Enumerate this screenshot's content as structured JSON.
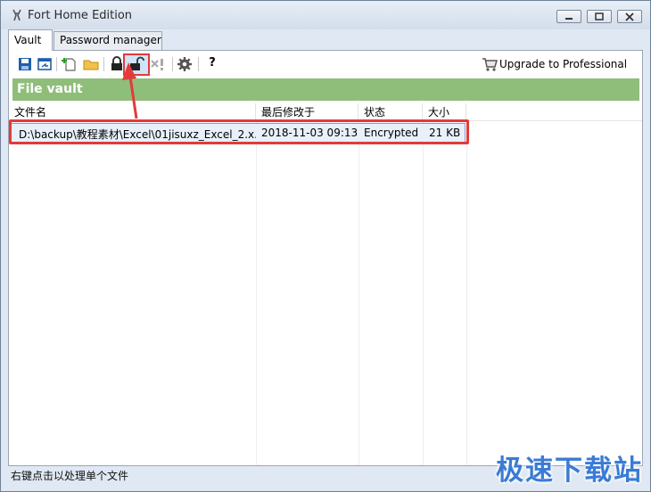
{
  "window": {
    "title": "Fort Home Edition"
  },
  "tabs": [
    {
      "label": "Vault",
      "active": true
    },
    {
      "label": "Password manager",
      "active": false
    }
  ],
  "toolbar": {
    "icons": [
      "save-icon",
      "open-vault-icon",
      "add-file-icon",
      "add-folder-icon",
      "lock-icon",
      "unlock-icon",
      "remove-icon",
      "settings-icon",
      "help-icon"
    ],
    "help_label": "?",
    "upgrade_label": "Upgrade to Professional"
  },
  "vault": {
    "title": "File vault",
    "columns": [
      "文件名",
      "最后修改于",
      "状态",
      "大小"
    ],
    "rows": [
      {
        "name": "D:\\backup\\教程素材\\Excel\\01jisuxz_Excel_2.x...",
        "modified": "2018-11-03 09:13",
        "status": "Encrypted",
        "size": "21 KB"
      }
    ]
  },
  "status_bar": {
    "text": "右键点击以处理单个文件"
  },
  "watermark": {
    "text": "极速下载站"
  },
  "colors": {
    "vault_header": "#8fbe7a",
    "highlight": "#e23b3b",
    "watermark": "#3a7bd5"
  }
}
